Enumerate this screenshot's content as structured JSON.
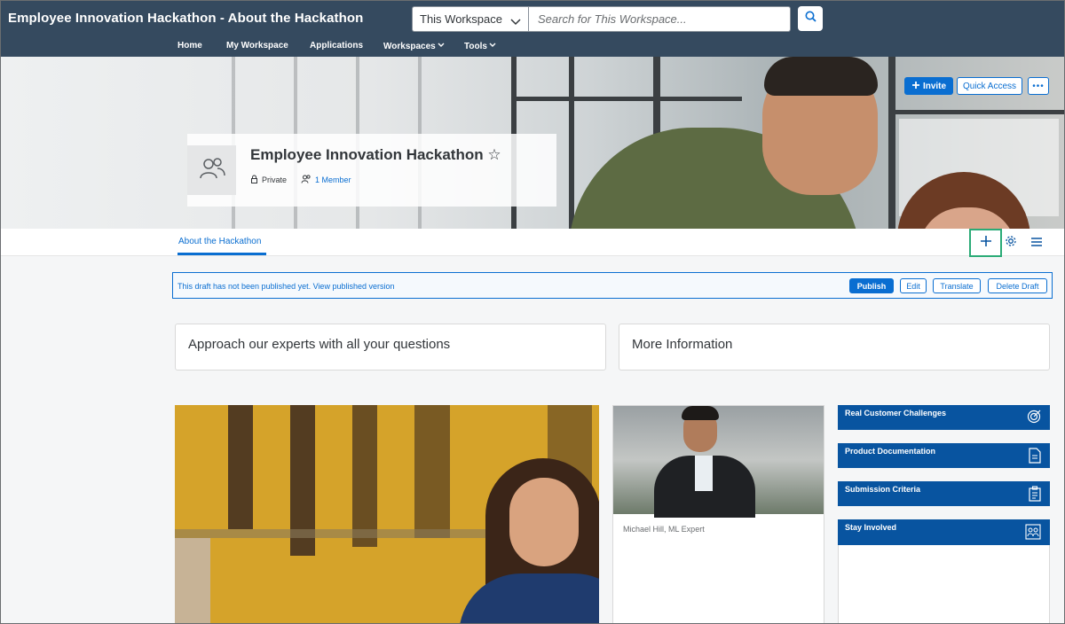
{
  "header": {
    "title": "Employee Innovation Hackathon - About the Hackathon",
    "scope": "This Workspace",
    "search_placeholder": "Search for This Workspace..."
  },
  "nav": {
    "items": [
      {
        "label": "Home"
      },
      {
        "label": "My Workspace"
      },
      {
        "label": "Applications"
      },
      {
        "label": "Workspaces"
      },
      {
        "label": "Tools"
      }
    ]
  },
  "banner": {
    "invite_label": "Invite",
    "quick_access_label": "Quick Access",
    "more_label": "•••"
  },
  "workspace": {
    "name": "Employee Innovation Hackathon",
    "star": "☆",
    "privacy": "Private",
    "members": "1 Member"
  },
  "tabs": {
    "active": "About the Hackathon"
  },
  "draft": {
    "message": "This draft has not been published yet. View published version",
    "publish": "Publish",
    "edit": "Edit",
    "translate": "Translate",
    "delete": "Delete Draft"
  },
  "cards": {
    "experts_title": "Approach our experts with all your questions",
    "more_info_title": "More Information",
    "expert_caption": "Michael Hill, ML Expert"
  },
  "tiles": [
    {
      "label": "Real Customer Challenges",
      "icon": "target-icon"
    },
    {
      "label": "Product Documentation",
      "icon": "document-icon"
    },
    {
      "label": "Submission Criteria",
      "icon": "clipboard-icon"
    },
    {
      "label": "Stay Involved",
      "icon": "people-icon"
    }
  ],
  "colors": {
    "shell": "#354a5f",
    "accent": "#0a6ed1",
    "tile": "#0854a0",
    "highlight": "#2bab77"
  }
}
